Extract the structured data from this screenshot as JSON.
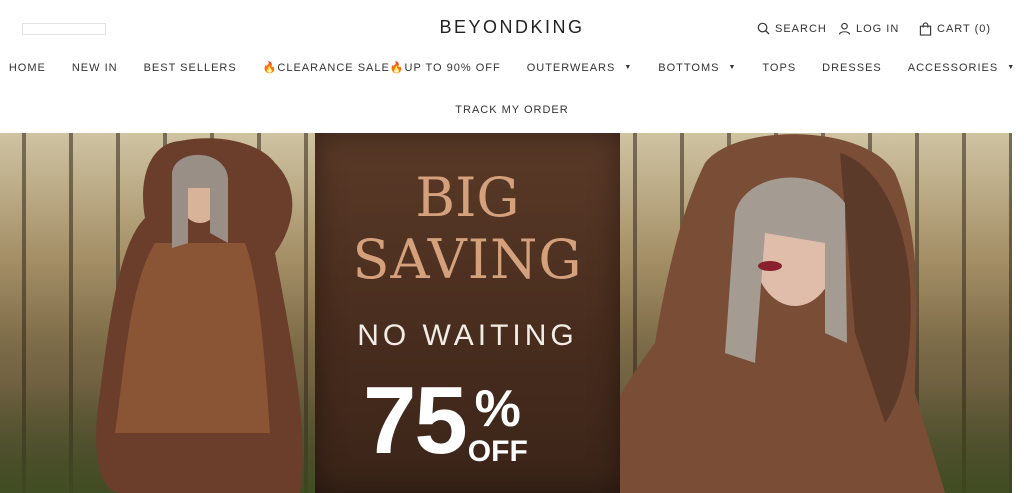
{
  "header": {
    "brand": "BEYONDKING",
    "search_label": "SEARCH",
    "login_label": "LOG IN",
    "cart_label": "CART (0)"
  },
  "nav": {
    "items": [
      {
        "label": "HOME",
        "has_dropdown": false
      },
      {
        "label": "NEW IN",
        "has_dropdown": false
      },
      {
        "label": "BEST SELLERS",
        "has_dropdown": false
      },
      {
        "label": "CLEARANCE SALE",
        "suffix": "UP TO 90% OFF",
        "icon": "fire-icon",
        "has_dropdown": false
      },
      {
        "label": "OUTERWEARS",
        "has_dropdown": true
      },
      {
        "label": "BOTTOMS",
        "has_dropdown": true
      },
      {
        "label": "TOPS",
        "has_dropdown": false
      },
      {
        "label": "DRESSES",
        "has_dropdown": false
      },
      {
        "label": "ACCESSORIES",
        "has_dropdown": true
      }
    ],
    "second_row": "TRACK MY ORDER"
  },
  "hero": {
    "line1": "BIG",
    "line2": "SAVING",
    "line3": "NO WAITING",
    "discount": "75",
    "percent": "%",
    "off": "OFF",
    "accent_color": "#d5a07c"
  }
}
